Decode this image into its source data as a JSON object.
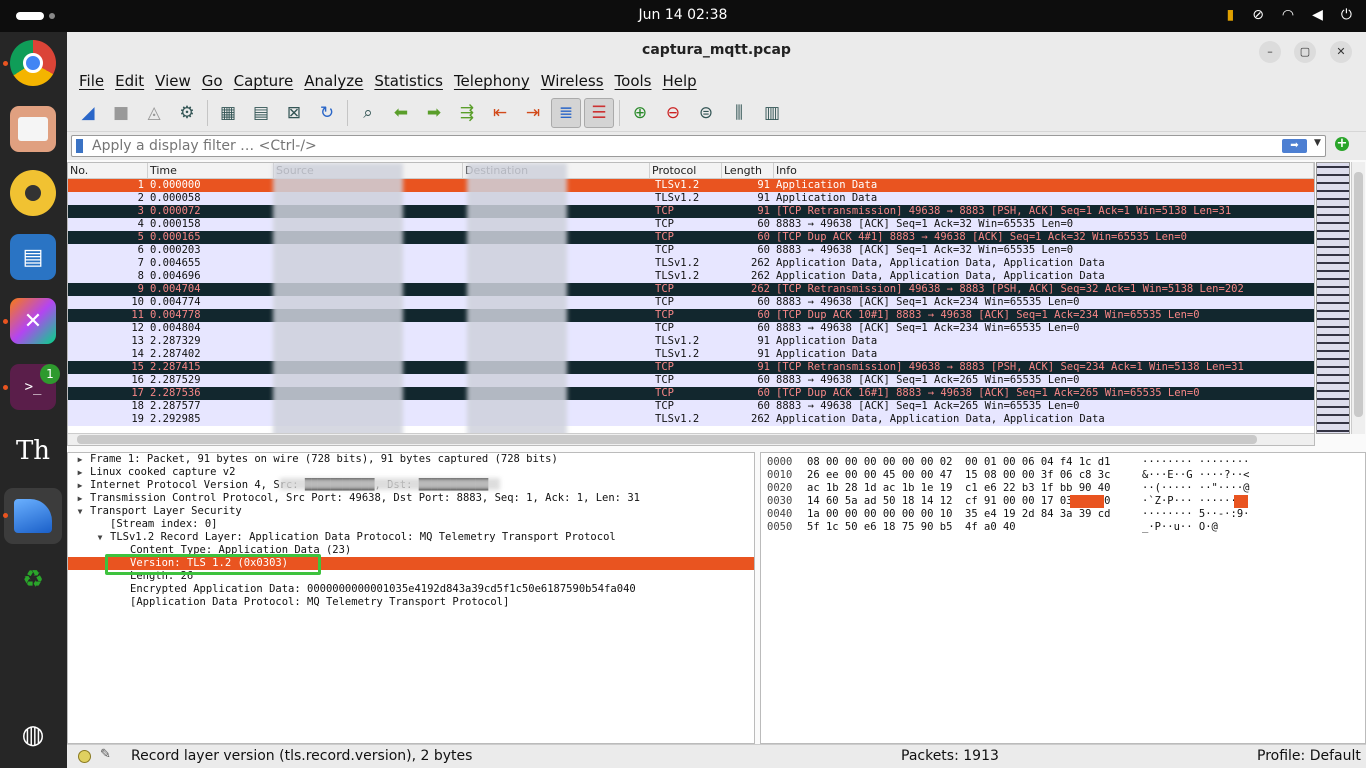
{
  "system": {
    "clock": "Jun 14  02:38",
    "terminal_badge": "1"
  },
  "window": {
    "title": "captura_mqtt.pcap"
  },
  "menu": [
    "File",
    "Edit",
    "View",
    "Go",
    "Capture",
    "Analyze",
    "Statistics",
    "Telephony",
    "Wireless",
    "Tools",
    "Help"
  ],
  "filter": {
    "placeholder": "Apply a display filter … <Ctrl-/>"
  },
  "columns": [
    "No.",
    "Time",
    "Source",
    "Destination",
    "Protocol",
    "Length",
    "Info"
  ],
  "packets": [
    {
      "no": "1",
      "time": "0.000000",
      "proto": "TLSv1.2",
      "len": "91",
      "info": "Application Data",
      "style": "sel"
    },
    {
      "no": "2",
      "time": "0.000058",
      "proto": "TLSv1.2",
      "len": "91",
      "info": "Application Data",
      "style": "normal"
    },
    {
      "no": "3",
      "time": "0.000072",
      "proto": "TCP",
      "len": "91",
      "info": "[TCP Retransmission] 49638 → 8883 [PSH, ACK] Seq=1 Ack=1 Win=5138 Len=31",
      "style": "bad"
    },
    {
      "no": "4",
      "time": "0.000158",
      "proto": "TCP",
      "len": "60",
      "info": "8883 → 49638 [ACK] Seq=1 Ack=32 Win=65535 Len=0",
      "style": "normal"
    },
    {
      "no": "5",
      "time": "0.000165",
      "proto": "TCP",
      "len": "60",
      "info": "[TCP Dup ACK 4#1] 8883 → 49638 [ACK] Seq=1 Ack=32 Win=65535 Len=0",
      "style": "bad"
    },
    {
      "no": "6",
      "time": "0.000203",
      "proto": "TCP",
      "len": "60",
      "info": "8883 → 49638 [ACK] Seq=1 Ack=32 Win=65535 Len=0",
      "style": "normal"
    },
    {
      "no": "7",
      "time": "0.004655",
      "proto": "TLSv1.2",
      "len": "262",
      "info": "Application Data, Application Data, Application Data",
      "style": "normal"
    },
    {
      "no": "8",
      "time": "0.004696",
      "proto": "TLSv1.2",
      "len": "262",
      "info": "Application Data, Application Data, Application Data",
      "style": "normal"
    },
    {
      "no": "9",
      "time": "0.004704",
      "proto": "TCP",
      "len": "262",
      "info": "[TCP Retransmission] 49638 → 8883 [PSH, ACK] Seq=32 Ack=1 Win=5138 Len=202",
      "style": "bad"
    },
    {
      "no": "10",
      "time": "0.004774",
      "proto": "TCP",
      "len": "60",
      "info": "8883 → 49638 [ACK] Seq=1 Ack=234 Win=65535 Len=0",
      "style": "normal"
    },
    {
      "no": "11",
      "time": "0.004778",
      "proto": "TCP",
      "len": "60",
      "info": "[TCP Dup ACK 10#1] 8883 → 49638 [ACK] Seq=1 Ack=234 Win=65535 Len=0",
      "style": "bad"
    },
    {
      "no": "12",
      "time": "0.004804",
      "proto": "TCP",
      "len": "60",
      "info": "8883 → 49638 [ACK] Seq=1 Ack=234 Win=65535 Len=0",
      "style": "normal"
    },
    {
      "no": "13",
      "time": "2.287329",
      "proto": "TLSv1.2",
      "len": "91",
      "info": "Application Data",
      "style": "normal"
    },
    {
      "no": "14",
      "time": "2.287402",
      "proto": "TLSv1.2",
      "len": "91",
      "info": "Application Data",
      "style": "normal"
    },
    {
      "no": "15",
      "time": "2.287415",
      "proto": "TCP",
      "len": "91",
      "info": "[TCP Retransmission] 49638 → 8883 [PSH, ACK] Seq=234 Ack=1 Win=5138 Len=31",
      "style": "bad"
    },
    {
      "no": "16",
      "time": "2.287529",
      "proto": "TCP",
      "len": "60",
      "info": "8883 → 49638 [ACK] Seq=1 Ack=265 Win=65535 Len=0",
      "style": "normal"
    },
    {
      "no": "17",
      "time": "2.287536",
      "proto": "TCP",
      "len": "60",
      "info": "[TCP Dup ACK 16#1] 8883 → 49638 [ACK] Seq=1 Ack=265 Win=65535 Len=0",
      "style": "bad"
    },
    {
      "no": "18",
      "time": "2.287577",
      "proto": "TCP",
      "len": "60",
      "info": "8883 → 49638 [ACK] Seq=1 Ack=265 Win=65535 Len=0",
      "style": "normal"
    },
    {
      "no": "19",
      "time": "2.292985",
      "proto": "TLSv1.2",
      "len": "262",
      "info": "Application Data, Application Data, Application Data",
      "style": "normal"
    }
  ],
  "details": [
    {
      "text": "Frame 1: Packet, 91 bytes on wire (728 bits), 91 bytes captured (728 bits)",
      "indent": 0,
      "tw": "▶",
      "sel": false
    },
    {
      "text": "Linux cooked capture v2",
      "indent": 0,
      "tw": "▶",
      "sel": false
    },
    {
      "text": "Internet Protocol Version 4, Src: ███████████, Dst: ███████████",
      "indent": 0,
      "tw": "▶",
      "sel": false
    },
    {
      "text": "Transmission Control Protocol, Src Port: 49638, Dst Port: 8883, Seq: 1, Ack: 1, Len: 31",
      "indent": 0,
      "tw": "▶",
      "sel": false
    },
    {
      "text": "Transport Layer Security",
      "indent": 0,
      "tw": "▼",
      "sel": false
    },
    {
      "text": "[Stream index: 0]",
      "indent": 1,
      "tw": "",
      "sel": false
    },
    {
      "text": "TLSv1.2 Record Layer: Application Data Protocol: MQ Telemetry Transport Protocol",
      "indent": 1,
      "tw": "▼",
      "sel": false
    },
    {
      "text": "Content Type: Application Data (23)",
      "indent": 2,
      "tw": "",
      "sel": false
    },
    {
      "text": "Version: TLS 1.2 (0x0303)",
      "indent": 2,
      "tw": "",
      "sel": true
    },
    {
      "text": "Length: 26",
      "indent": 2,
      "tw": "",
      "sel": false
    },
    {
      "text": "Encrypted Application Data: 0000000000001035e4192d843a39cd5f1c50e6187590b54fa040",
      "indent": 2,
      "tw": "",
      "sel": false
    },
    {
      "text": "[Application Data Protocol: MQ Telemetry Transport Protocol]",
      "indent": 2,
      "tw": "",
      "sel": false
    }
  ],
  "hex": [
    {
      "off": "0000",
      "hex": "08 00 00 00 00 00 00 02  00 01 00 06 04 f4 1c d1",
      "ascii": "········ ········"
    },
    {
      "off": "0010",
      "hex": "26 ee 00 00 45 00 00 47  15 08 00 00 3f 06 c8 3c",
      "ascii": "&···E··G ····?··<"
    },
    {
      "off": "0020",
      "hex": "ac 1b 28 1d ac 1b 1e 19  c1 e6 22 b3 1f bb 90 40",
      "ascii": "··(····· ··\"····@"
    },
    {
      "off": "0030",
      "hex": "14 60 5a ad 50 18 14 12  cf 91 00 00 17 03 03 00",
      "ascii": "·`Z·P··· ········"
    },
    {
      "off": "0040",
      "hex": "1a 00 00 00 00 00 00 10  35 e4 19 2d 84 3a 39 cd",
      "ascii": "········ 5··-·:9·"
    },
    {
      "off": "0050",
      "hex": "5f 1c 50 e6 18 75 90 b5  4f a0 40",
      "ascii": "_·P··u·· O·@"
    }
  ],
  "status": {
    "message": "Record layer version (tls.record.version), 2 bytes",
    "packets": "Packets: 1913",
    "profile": "Profile: Default"
  },
  "colors": {
    "selected": "#e95420",
    "bad_bg": "#12272e",
    "bad_fg": "#f78787",
    "normal_bg": "#e7e6ff",
    "highlight_box": "#3ec23e"
  }
}
